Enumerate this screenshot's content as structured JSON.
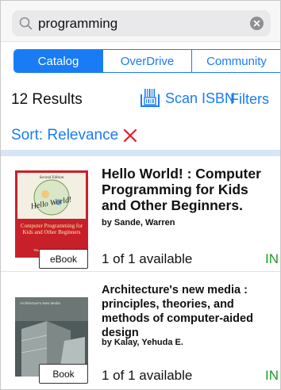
{
  "search": {
    "value": "programming"
  },
  "tabs": [
    {
      "label": "Catalog",
      "active": true
    },
    {
      "label": "OverDrive",
      "active": false
    },
    {
      "label": "Community",
      "active": false
    }
  ],
  "results_bar": {
    "count_label": "12 Results",
    "scan_label": "Scan ISBN",
    "filters_label": "Filters"
  },
  "sort": {
    "label": "Sort: Relevance"
  },
  "results": [
    {
      "title": "Hello World! : Computer Programming for Kids and Other Beginners.",
      "author": "by Sande, Warren",
      "format": "eBook",
      "availability": "1 of 1 available",
      "status": "IN",
      "cover_text": {
        "top": "Second Edition",
        "big": "Hello World!",
        "sub": "Computer Programming for Kids and Other Beginners",
        "authors": "Warren and Carter Sande"
      }
    },
    {
      "title": "Architecture's new media : principles, theories, and methods of computer-aided design",
      "author": "by Kalay, Yehuda E.",
      "format": "Book",
      "availability": "1 of 1 available",
      "status": "IN",
      "cover_text": {
        "top": "Architecture's New Media"
      }
    }
  ],
  "colors": {
    "accent": "#1a7cf4",
    "available": "#1a9b2a",
    "remove": "#e0202a",
    "band": "#d6e6f8"
  }
}
